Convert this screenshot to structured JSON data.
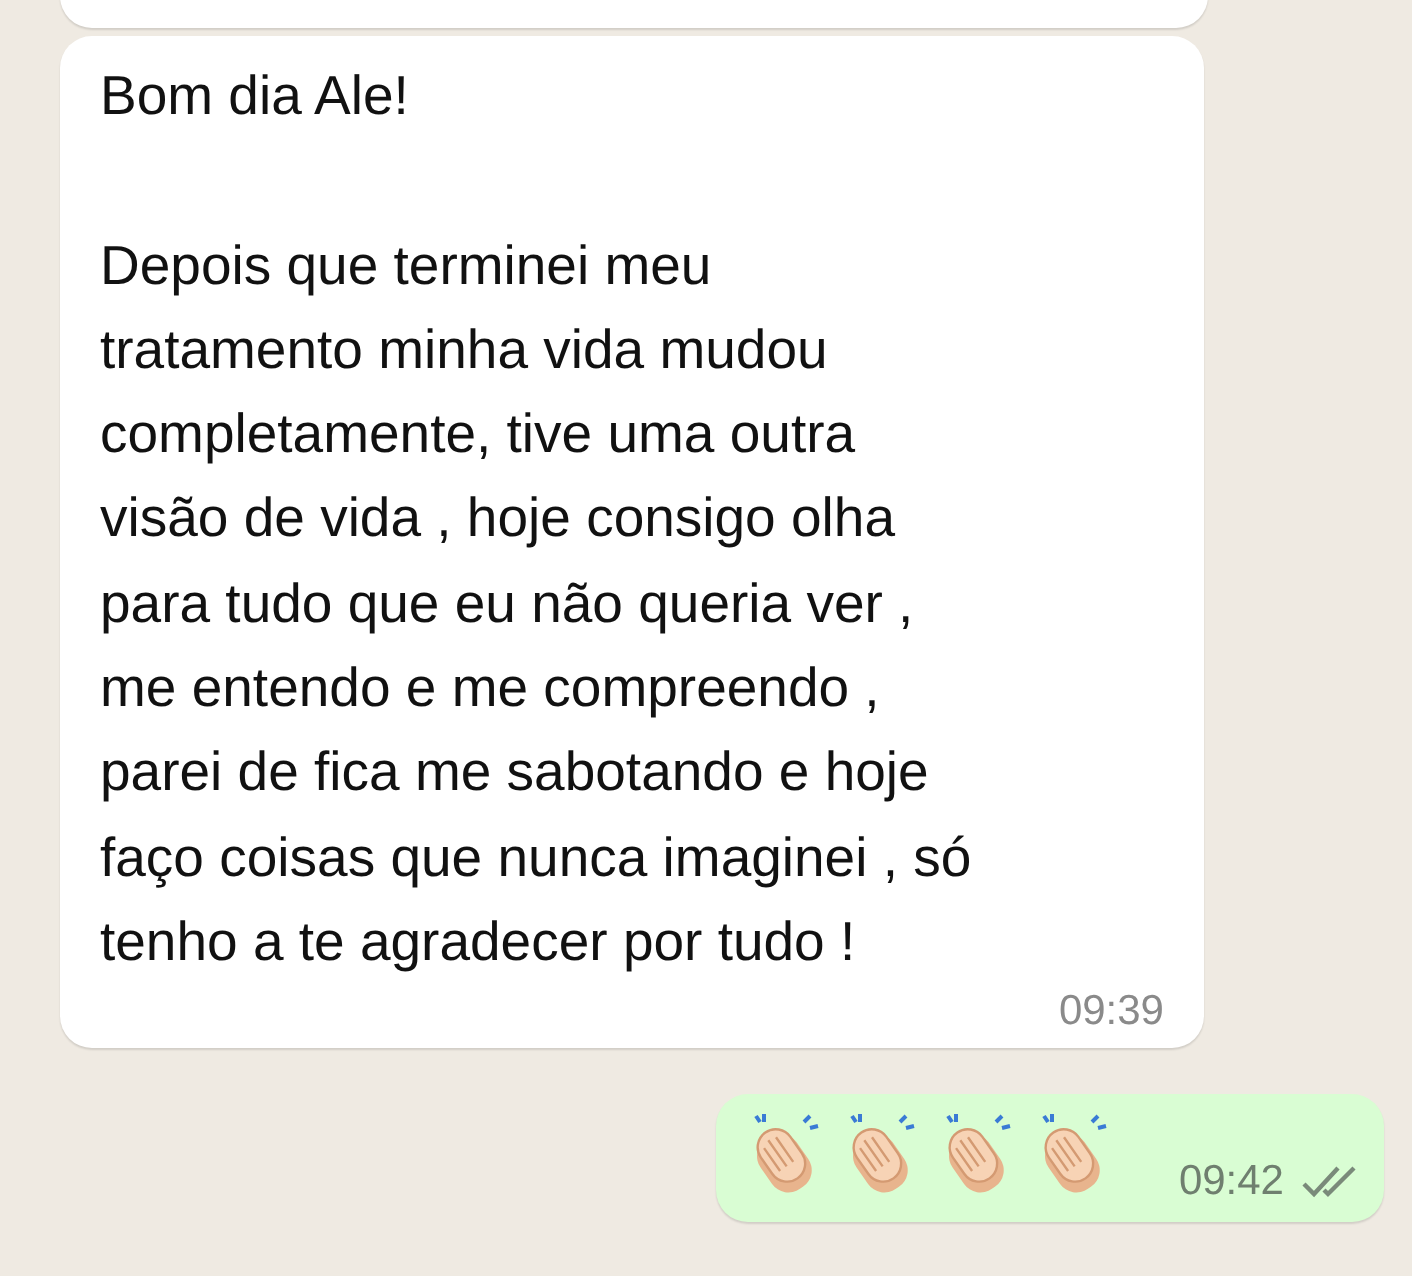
{
  "messages": [
    {
      "kind": "incoming",
      "text": "Bom dia Ale!\n\nDepois que terminei meu\ntratamento minha vida mudou\ncompletamente, tive uma outra\nvisão de vida , hoje consigo olha\npara tudo que eu não queria ver ,\nme entendo e me compreendo ,\nparei de fica me sabotando e hoje\nfaço coisas que nunca imaginei , só\ntenho a te agradecer por tudo !",
      "time": "09:39"
    },
    {
      "kind": "outgoing",
      "emojis": [
        {
          "kind": "clap"
        },
        {
          "kind": "clap"
        },
        {
          "kind": "clap"
        },
        {
          "kind": "clap"
        }
      ],
      "time": "09:42",
      "read": false
    }
  ]
}
